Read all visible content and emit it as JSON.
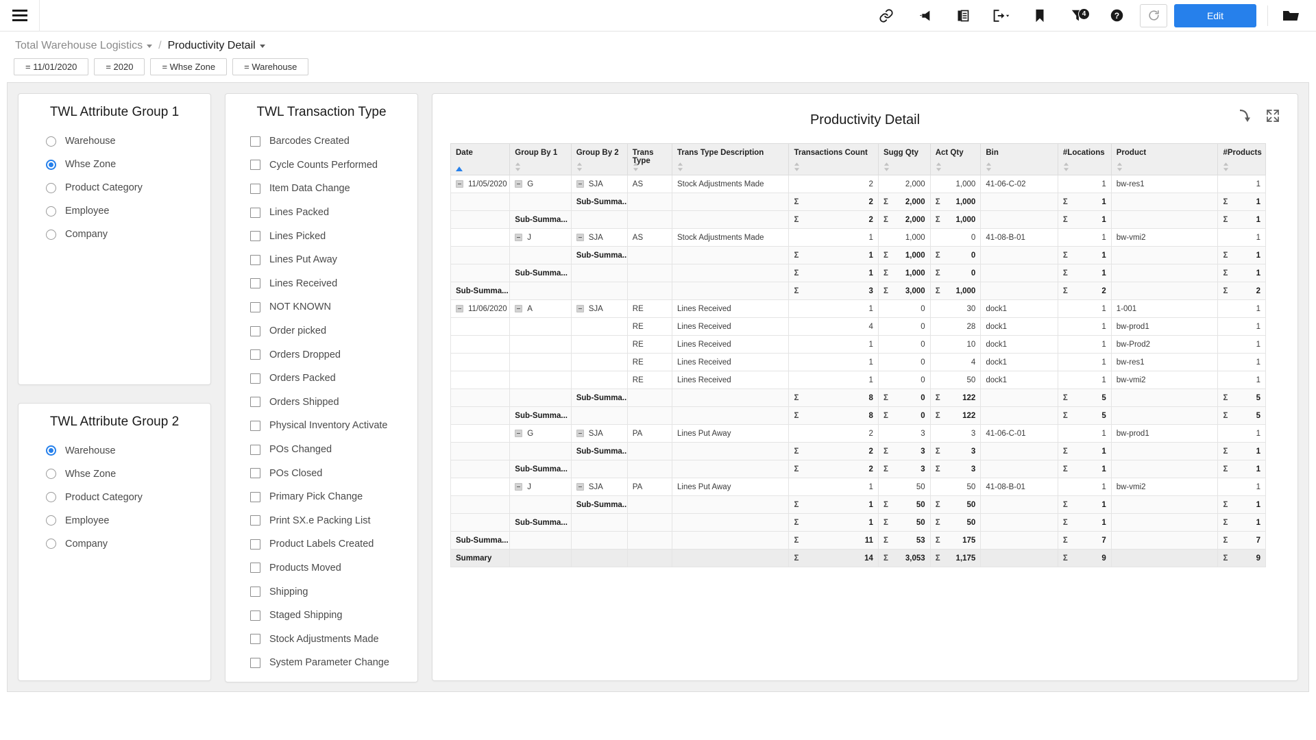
{
  "topbar": {
    "icons": [
      {
        "name": "link-icon",
        "label": "Link"
      },
      {
        "name": "megaphone-icon",
        "label": "Announcements"
      },
      {
        "name": "copy-icon",
        "label": "Copy"
      },
      {
        "name": "export-icon",
        "label": "Export"
      },
      {
        "name": "bookmark-icon",
        "label": "Bookmark"
      },
      {
        "name": "filter-icon",
        "label": "Filters"
      },
      {
        "name": "help-icon",
        "label": "Help"
      }
    ],
    "filter_count": "4",
    "refresh_label": "Refresh",
    "edit_label": "Edit",
    "folder_label": "Open"
  },
  "breadcrumb": {
    "app": "Total Warehouse Logistics",
    "separator": "/",
    "page": "Productivity Detail"
  },
  "filter_chips": [
    "= 11/01/2020",
    "= 2020",
    "= Whse Zone",
    "= Warehouse"
  ],
  "attribute_group_1": {
    "title": "TWL Attribute Group 1",
    "selected": "Whse Zone",
    "options": [
      "Warehouse",
      "Whse Zone",
      "Product Category",
      "Employee",
      "Company"
    ]
  },
  "attribute_group_2": {
    "title": "TWL Attribute Group 2",
    "selected": "Warehouse",
    "options": [
      "Warehouse",
      "Whse Zone",
      "Product Category",
      "Employee",
      "Company"
    ]
  },
  "transaction_type": {
    "title": "TWL Transaction Type",
    "options": [
      {
        "label": "Barcodes Created",
        "checked": false
      },
      {
        "label": "Cycle Counts Performed",
        "checked": false
      },
      {
        "label": "Item Data Change",
        "checked": false
      },
      {
        "label": "Lines Packed",
        "checked": false
      },
      {
        "label": "Lines Picked",
        "checked": false
      },
      {
        "label": "Lines Put Away",
        "checked": false
      },
      {
        "label": "Lines Received",
        "checked": false
      },
      {
        "label": "NOT KNOWN",
        "checked": false
      },
      {
        "label": "Order picked",
        "checked": false
      },
      {
        "label": "Orders Dropped",
        "checked": false
      },
      {
        "label": "Orders Packed",
        "checked": false
      },
      {
        "label": "Orders Shipped",
        "checked": false
      },
      {
        "label": "Physical Inventory Activate",
        "checked": false
      },
      {
        "label": "POs Changed",
        "checked": false
      },
      {
        "label": "POs Closed",
        "checked": false
      },
      {
        "label": "Primary Pick Change",
        "checked": false
      },
      {
        "label": "Print SX.e Packing List",
        "checked": false
      },
      {
        "label": "Product Labels Created",
        "checked": false
      },
      {
        "label": "Products Moved",
        "checked": false
      },
      {
        "label": "Shipping",
        "checked": false
      },
      {
        "label": "Staged Shipping",
        "checked": false
      },
      {
        "label": "Stock Adjustments Made",
        "checked": false
      },
      {
        "label": "System Parameter Change",
        "checked": false
      }
    ]
  },
  "report": {
    "title": "Productivity Detail",
    "tools": [
      {
        "name": "drill-arrow-icon",
        "label": "Drill"
      },
      {
        "name": "fullscreen-icon",
        "label": "Full screen"
      }
    ],
    "columns": [
      {
        "label": "Date",
        "sort": "asc"
      },
      {
        "label": "Group By 1",
        "sort": "none"
      },
      {
        "label": "Group By 2",
        "sort": "none"
      },
      {
        "label": "Trans Type",
        "sort": "none"
      },
      {
        "label": "Trans Type Description",
        "sort": "none"
      },
      {
        "label": "Transactions Count",
        "sort": "none"
      },
      {
        "label": "Sugg Qty",
        "sort": "none"
      },
      {
        "label": "Act Qty",
        "sort": "none"
      },
      {
        "label": "Bin",
        "sort": "none"
      },
      {
        "label": "#Locations",
        "sort": "none"
      },
      {
        "label": "Product",
        "sort": "none"
      },
      {
        "label": "#Products",
        "sort": "none"
      }
    ],
    "sub_summary_label": "Sub-Summa...",
    "summary_label": "Summary",
    "sigma": "Σ",
    "rows": [
      {
        "type": "data",
        "date": "11/05/2020",
        "date_exp": true,
        "g1": "G",
        "g1_exp": true,
        "g2": "SJA",
        "g2_exp": true,
        "tt": "AS",
        "ttd": "Stock Adjustments Made",
        "cnt": "2",
        "sugg": "2,000",
        "act": "1,000",
        "bin": "41-06-C-02",
        "locs": "1",
        "prod": "bw-res1",
        "prods": "1"
      },
      {
        "type": "sub2",
        "date": "",
        "g1": "",
        "g2": "Sub-Summa...",
        "tt": "",
        "ttd": "",
        "cnt": "2",
        "sugg": "2,000",
        "act": "1,000",
        "bin": "",
        "locs": "1",
        "prod": "",
        "prods": "1"
      },
      {
        "type": "sub1",
        "date": "",
        "g1": "Sub-Summa...",
        "g2": "",
        "tt": "",
        "ttd": "",
        "cnt": "2",
        "sugg": "2,000",
        "act": "1,000",
        "bin": "",
        "locs": "1",
        "prod": "",
        "prods": "1"
      },
      {
        "type": "data",
        "date": "",
        "g1": "J",
        "g1_exp": true,
        "g2": "SJA",
        "g2_exp": true,
        "tt": "AS",
        "ttd": "Stock Adjustments Made",
        "cnt": "1",
        "sugg": "1,000",
        "act": "0",
        "bin": "41-08-B-01",
        "locs": "1",
        "prod": "bw-vmi2",
        "prods": "1"
      },
      {
        "type": "sub2",
        "date": "",
        "g1": "",
        "g2": "Sub-Summa...",
        "tt": "",
        "ttd": "",
        "cnt": "1",
        "sugg": "1,000",
        "act": "0",
        "bin": "",
        "locs": "1",
        "prod": "",
        "prods": "1"
      },
      {
        "type": "sub1",
        "date": "",
        "g1": "Sub-Summa...",
        "g2": "",
        "tt": "",
        "ttd": "",
        "cnt": "1",
        "sugg": "1,000",
        "act": "0",
        "bin": "",
        "locs": "1",
        "prod": "",
        "prods": "1"
      },
      {
        "type": "sub0",
        "date": "Sub-Summa...",
        "g1": "",
        "g2": "",
        "tt": "",
        "ttd": "",
        "cnt": "3",
        "sugg": "3,000",
        "act": "1,000",
        "bin": "",
        "locs": "2",
        "prod": "",
        "prods": "2"
      },
      {
        "type": "data",
        "date": "11/06/2020",
        "date_exp": true,
        "g1": "A",
        "g1_exp": true,
        "g2": "SJA",
        "g2_exp": true,
        "tt": "RE",
        "ttd": "Lines Received",
        "cnt": "1",
        "sugg": "0",
        "act": "30",
        "bin": "dock1",
        "locs": "1",
        "prod": "1-001",
        "prods": "1"
      },
      {
        "type": "data",
        "date": "",
        "g1": "",
        "g2": "",
        "tt": "RE",
        "ttd": "Lines Received",
        "cnt": "4",
        "sugg": "0",
        "act": "28",
        "bin": "dock1",
        "locs": "1",
        "prod": "bw-prod1",
        "prods": "1"
      },
      {
        "type": "data",
        "date": "",
        "g1": "",
        "g2": "",
        "tt": "RE",
        "ttd": "Lines Received",
        "cnt": "1",
        "sugg": "0",
        "act": "10",
        "bin": "dock1",
        "locs": "1",
        "prod": "bw-Prod2",
        "prods": "1"
      },
      {
        "type": "data",
        "date": "",
        "g1": "",
        "g2": "",
        "tt": "RE",
        "ttd": "Lines Received",
        "cnt": "1",
        "sugg": "0",
        "act": "4",
        "bin": "dock1",
        "locs": "1",
        "prod": "bw-res1",
        "prods": "1"
      },
      {
        "type": "data",
        "date": "",
        "g1": "",
        "g2": "",
        "tt": "RE",
        "ttd": "Lines Received",
        "cnt": "1",
        "sugg": "0",
        "act": "50",
        "bin": "dock1",
        "locs": "1",
        "prod": "bw-vmi2",
        "prods": "1"
      },
      {
        "type": "sub2",
        "date": "",
        "g1": "",
        "g2": "Sub-Summa...",
        "tt": "",
        "ttd": "",
        "cnt": "8",
        "sugg": "0",
        "act": "122",
        "bin": "",
        "locs": "5",
        "prod": "",
        "prods": "5"
      },
      {
        "type": "sub1",
        "date": "",
        "g1": "Sub-Summa...",
        "g2": "",
        "tt": "",
        "ttd": "",
        "cnt": "8",
        "sugg": "0",
        "act": "122",
        "bin": "",
        "locs": "5",
        "prod": "",
        "prods": "5"
      },
      {
        "type": "data",
        "date": "",
        "g1": "G",
        "g1_exp": true,
        "g2": "SJA",
        "g2_exp": true,
        "tt": "PA",
        "ttd": "Lines Put Away",
        "cnt": "2",
        "sugg": "3",
        "act": "3",
        "bin": "41-06-C-01",
        "locs": "1",
        "prod": "bw-prod1",
        "prods": "1"
      },
      {
        "type": "sub2",
        "date": "",
        "g1": "",
        "g2": "Sub-Summa...",
        "tt": "",
        "ttd": "",
        "cnt": "2",
        "sugg": "3",
        "act": "3",
        "bin": "",
        "locs": "1",
        "prod": "",
        "prods": "1"
      },
      {
        "type": "sub1",
        "date": "",
        "g1": "Sub-Summa...",
        "g2": "",
        "tt": "",
        "ttd": "",
        "cnt": "2",
        "sugg": "3",
        "act": "3",
        "bin": "",
        "locs": "1",
        "prod": "",
        "prods": "1"
      },
      {
        "type": "data",
        "date": "",
        "g1": "J",
        "g1_exp": true,
        "g2": "SJA",
        "g2_exp": true,
        "tt": "PA",
        "ttd": "Lines Put Away",
        "cnt": "1",
        "sugg": "50",
        "act": "50",
        "bin": "41-08-B-01",
        "locs": "1",
        "prod": "bw-vmi2",
        "prods": "1"
      },
      {
        "type": "sub2",
        "date": "",
        "g1": "",
        "g2": "Sub-Summa...",
        "tt": "",
        "ttd": "",
        "cnt": "1",
        "sugg": "50",
        "act": "50",
        "bin": "",
        "locs": "1",
        "prod": "",
        "prods": "1"
      },
      {
        "type": "sub1",
        "date": "",
        "g1": "Sub-Summa...",
        "g2": "",
        "tt": "",
        "ttd": "",
        "cnt": "1",
        "sugg": "50",
        "act": "50",
        "bin": "",
        "locs": "1",
        "prod": "",
        "prods": "1"
      },
      {
        "type": "sub0",
        "date": "Sub-Summa...",
        "g1": "",
        "g2": "",
        "tt": "",
        "ttd": "",
        "cnt": "11",
        "sugg": "53",
        "act": "175",
        "bin": "",
        "locs": "7",
        "prod": "",
        "prods": "7"
      },
      {
        "type": "summary",
        "date": "Summary",
        "g1": "",
        "g2": "",
        "tt": "",
        "ttd": "",
        "cnt": "14",
        "sugg": "3,053",
        "act": "1,175",
        "bin": "",
        "locs": "9",
        "prod": "",
        "prods": "9"
      }
    ]
  }
}
